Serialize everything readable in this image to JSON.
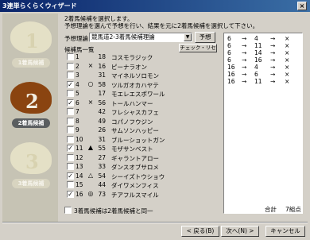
{
  "window": {
    "title": "3連単らくらくウィザード",
    "close_glyph": "×"
  },
  "sidebar": {
    "steps": [
      {
        "num": "1",
        "label": "1着馬候補",
        "active": false
      },
      {
        "num": "2",
        "label": "2着馬候補",
        "active": true
      },
      {
        "num": "3",
        "label": "3着馬候補",
        "active": false
      }
    ]
  },
  "instructions": {
    "line1": "2着馬候補を選択します。",
    "line2": "予想理論を選んで予想を行い、結果を元に2着馬候補を選択して下さい。"
  },
  "theory": {
    "label": "予想理論",
    "value": "競馬道2-3着馬候補理論",
    "predict_button": "予想"
  },
  "candidates": {
    "label": "候補馬一覧",
    "check_reset_button": "チェック・リセット",
    "rows": [
      {
        "rank": "1",
        "checked": false,
        "mark": "",
        "num": "18",
        "name": "コスモラジック"
      },
      {
        "rank": "2",
        "checked": false,
        "mark": "×",
        "num": "16",
        "name": "ピーナラオン"
      },
      {
        "rank": "3",
        "checked": false,
        "mark": "",
        "num": "31",
        "name": "マイネルソロモン"
      },
      {
        "rank": "4",
        "checked": true,
        "mark": "○",
        "num": "58",
        "name": "ツルガオカハヤテ"
      },
      {
        "rank": "5",
        "checked": false,
        "mark": "",
        "num": "17",
        "name": "モエレエスポワール"
      },
      {
        "rank": "6",
        "checked": true,
        "mark": "×",
        "num": "56",
        "name": "トールハンマー"
      },
      {
        "rank": "7",
        "checked": false,
        "mark": "",
        "num": "42",
        "name": "フレシャスカフェ"
      },
      {
        "rank": "8",
        "checked": false,
        "mark": "",
        "num": "49",
        "name": "コパノフウジン"
      },
      {
        "rank": "9",
        "checked": false,
        "mark": "",
        "num": "26",
        "name": "サムソンハッピー"
      },
      {
        "rank": "10",
        "checked": false,
        "mark": "",
        "num": "31",
        "name": "ブルーショットガン"
      },
      {
        "rank": "11",
        "checked": true,
        "mark": "▲",
        "num": "55",
        "name": "モザサンベスト"
      },
      {
        "rank": "12",
        "checked": false,
        "mark": "",
        "num": "27",
        "name": "ギャラントアロー"
      },
      {
        "rank": "13",
        "checked": false,
        "mark": "",
        "num": "33",
        "name": "ダンスオブサロメ"
      },
      {
        "rank": "14",
        "checked": true,
        "mark": "△",
        "num": "54",
        "name": "シーイズトウショウ"
      },
      {
        "rank": "15",
        "checked": false,
        "mark": "",
        "num": "44",
        "name": "ダイワメンフィス"
      },
      {
        "rank": "16",
        "checked": true,
        "mark": "◎",
        "num": "73",
        "name": "チアフルスマイル"
      }
    ]
  },
  "same_option": {
    "label": "3着馬候補は2着馬候補と同一",
    "checked": false
  },
  "combinations": {
    "arrow": "→",
    "rows": [
      [
        "6",
        "4",
        "×"
      ],
      [
        "6",
        "11",
        "×"
      ],
      [
        "6",
        "14",
        "×"
      ],
      [
        "6",
        "16",
        "×"
      ],
      [
        "16",
        "4",
        "×"
      ],
      [
        "16",
        "6",
        "×"
      ],
      [
        "16",
        "11",
        "×"
      ]
    ],
    "total_label": "合計",
    "total_value": "7組点"
  },
  "buttons": {
    "back": "< 戻る(B)",
    "next": "次へ(N) >",
    "cancel": "キャンセル"
  }
}
